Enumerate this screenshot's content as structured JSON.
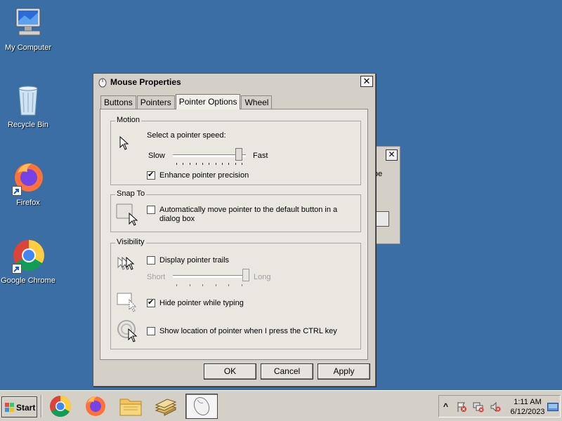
{
  "desktop": {
    "icons": [
      {
        "label": "My Computer"
      },
      {
        "label": "Recycle Bin"
      },
      {
        "label": "Firefox"
      },
      {
        "label": "Google Chrome"
      }
    ]
  },
  "background_window": {
    "close": "✕",
    "text_fragment": "be"
  },
  "dialog": {
    "title": "Mouse Properties",
    "close": "✕",
    "tabs": [
      {
        "label": "Buttons",
        "active": false
      },
      {
        "label": "Pointers",
        "active": false
      },
      {
        "label": "Pointer Options",
        "active": true
      },
      {
        "label": "Wheel",
        "active": false
      }
    ],
    "motion": {
      "title": "Motion",
      "prompt": "Select a pointer speed:",
      "slow": "Slow",
      "fast": "Fast",
      "speed_level": 0.9,
      "enhance_label": "Enhance pointer precision",
      "enhance_checked": true
    },
    "snap": {
      "title": "Snap To",
      "line1": "Automatically move pointer to the default button in a",
      "line2": "dialog box",
      "checked": false
    },
    "visibility": {
      "title": "Visibility",
      "trails_label": "Display pointer trails",
      "trails_checked": false,
      "short": "Short",
      "long": "Long",
      "trail_level": 1.0,
      "hide_label": "Hide pointer while typing",
      "hide_checked": true,
      "ctrl_label": "Show location of pointer when I press the CTRL key",
      "ctrl_checked": false
    },
    "buttons": {
      "ok": "OK",
      "cancel": "Cancel",
      "apply": "Apply"
    }
  },
  "taskbar": {
    "start": "Start",
    "clock_time": "1:11 AM",
    "clock_date": "6/12/2023",
    "tray_expand": "^"
  },
  "colors": {
    "desktop": "#3a6ea5",
    "chrome": "#d4d0c8",
    "panel": "#e9e7e0"
  }
}
